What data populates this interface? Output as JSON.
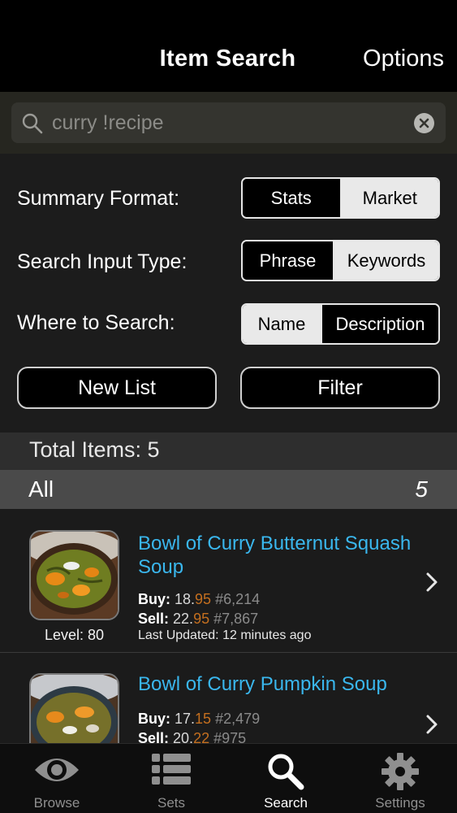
{
  "nav": {
    "title": "Item Search",
    "options_label": "Options"
  },
  "search": {
    "query": "curry !recipe"
  },
  "options": {
    "summary_format": {
      "label": "Summary Format:",
      "segments": [
        "Stats",
        "Market"
      ],
      "selected": "Market"
    },
    "search_input_type": {
      "label": "Search Input Type:",
      "segments": [
        "Phrase",
        "Keywords"
      ],
      "selected": "Keywords"
    },
    "where_to_search": {
      "label": "Where to Search:",
      "segments": [
        "Name",
        "Description"
      ],
      "selected": "Name"
    },
    "new_list_label": "New List",
    "filter_label": "Filter"
  },
  "total_label": "Total Items: 5",
  "section": {
    "title": "All",
    "count": "5"
  },
  "items": [
    {
      "name": "Bowl of Curry Butternut Squash Soup",
      "buy_label": "Buy:",
      "buy_whole": "18.",
      "buy_cents": "95",
      "buy_rank": "#6,214",
      "sell_label": "Sell:",
      "sell_whole": "22.",
      "sell_cents": "95",
      "sell_rank": "#7,867",
      "updated": "Last Updated: 12 minutes ago",
      "level": "Level: 80"
    },
    {
      "name": "Bowl of Curry Pumpkin Soup",
      "buy_label": "Buy:",
      "buy_whole": "17.",
      "buy_cents": "15",
      "buy_rank": "#2,479",
      "sell_label": "Sell:",
      "sell_whole": "20.",
      "sell_cents": "22",
      "sell_rank": "#975"
    }
  ],
  "tabs": [
    {
      "label": "Browse",
      "icon": "eye-icon"
    },
    {
      "label": "Sets",
      "icon": "list-icon"
    },
    {
      "label": "Search",
      "icon": "search-icon",
      "active": true
    },
    {
      "label": "Settings",
      "icon": "gear-icon"
    }
  ],
  "colors": {
    "link": "#3ab7ee",
    "cents": "#c46f1f",
    "rank": "#8a8a8a",
    "selected_segment": "#e9e9e9"
  }
}
